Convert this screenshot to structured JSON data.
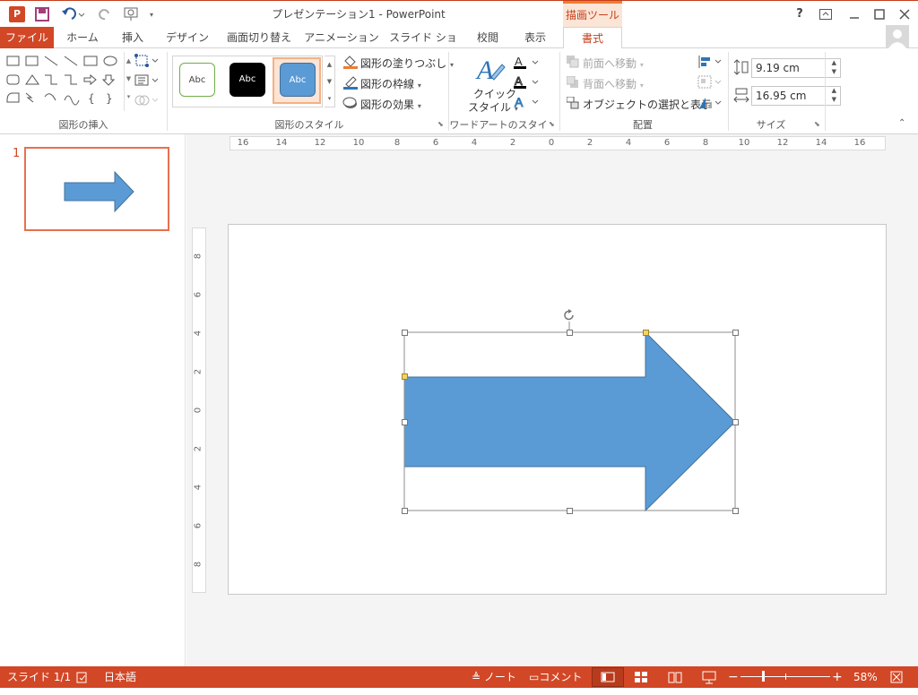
{
  "window": {
    "title": "プレゼンテーション1 - PowerPoint",
    "context_tab_group": "描画ツール",
    "help": "?"
  },
  "tabs": [
    "ファイル",
    "ホーム",
    "挿入",
    "デザイン",
    "画面切り替え",
    "アニメーション",
    "スライド ショー",
    "校閲",
    "表示",
    "書式"
  ],
  "ribbon": {
    "groups": {
      "insert_shapes": "図形の挿入",
      "shape_styles": "図形のスタイル",
      "wordart_styles": "ワードアートのスタイル",
      "arrange": "配置",
      "size": "サイズ"
    },
    "style_sample": "Abc",
    "shape_fill": "図形の塗りつぶし",
    "shape_outline": "図形の枠線",
    "shape_effects": "図形の効果",
    "quick_style_line1": "クイック",
    "quick_style_line2": "スタイル",
    "bring_forward": "前面へ移動",
    "send_backward": "背面へ移動",
    "selection_pane": "オブジェクトの選択と表示",
    "height": "9.19 cm",
    "width": "16.95 cm"
  },
  "thumbnail": {
    "number": "1"
  },
  "ruler": {
    "h_ticks": [
      "16",
      "14",
      "12",
      "10",
      "8",
      "6",
      "4",
      "2",
      "0",
      "2",
      "4",
      "6",
      "8",
      "10",
      "12",
      "14",
      "16"
    ],
    "v_ticks": [
      "8",
      "6",
      "4",
      "2",
      "0",
      "2",
      "4",
      "6",
      "8"
    ]
  },
  "status": {
    "slide": "スライド 1/1",
    "language": "日本語",
    "notes": "ノート",
    "comments": "コメント",
    "zoom": "58%"
  },
  "colors": {
    "accent": "#d24726",
    "shape_fill": "#5b9bd5",
    "shape_outline": "#41719c"
  }
}
